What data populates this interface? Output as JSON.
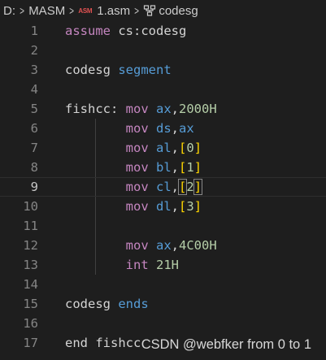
{
  "breadcrumb": {
    "drive": "D:",
    "folder": "MASM",
    "file_icon_label": "ASM",
    "file": "1.asm",
    "symbol": "codesg",
    "symbol_icon": "symbol-structure-icon",
    "separator_icon": "chevron-right-icon"
  },
  "editor": {
    "current_line": 9,
    "lines": [
      {
        "num": "1",
        "tokens": [
          {
            "t": "assume ",
            "c": "op"
          },
          {
            "t": "cs:codesg",
            "c": "ident"
          }
        ]
      },
      {
        "num": "2",
        "tokens": []
      },
      {
        "num": "3",
        "tokens": [
          {
            "t": "codesg ",
            "c": "ident"
          },
          {
            "t": "segment",
            "c": "kw"
          }
        ]
      },
      {
        "num": "4",
        "tokens": []
      },
      {
        "num": "5",
        "tokens": [
          {
            "t": "fishcc: ",
            "c": "ident"
          },
          {
            "t": "mov ",
            "c": "op"
          },
          {
            "t": "ax",
            "c": "kw"
          },
          {
            "t": ",",
            "c": "ident"
          },
          {
            "t": "2000H",
            "c": "num"
          }
        ]
      },
      {
        "num": "6",
        "tokens": [
          {
            "t": "        ",
            "c": "ident"
          },
          {
            "t": "mov ",
            "c": "op"
          },
          {
            "t": "ds",
            "c": "kw"
          },
          {
            "t": ",",
            "c": "ident"
          },
          {
            "t": "ax",
            "c": "kw"
          }
        ]
      },
      {
        "num": "7",
        "tokens": [
          {
            "t": "        ",
            "c": "ident"
          },
          {
            "t": "mov ",
            "c": "op"
          },
          {
            "t": "al",
            "c": "kw"
          },
          {
            "t": ",",
            "c": "ident"
          },
          {
            "t": "[",
            "c": "bracket"
          },
          {
            "t": "0",
            "c": "num"
          },
          {
            "t": "]",
            "c": "bracket"
          }
        ]
      },
      {
        "num": "8",
        "tokens": [
          {
            "t": "        ",
            "c": "ident"
          },
          {
            "t": "mov ",
            "c": "op"
          },
          {
            "t": "bl",
            "c": "kw"
          },
          {
            "t": ",",
            "c": "ident"
          },
          {
            "t": "[",
            "c": "bracket"
          },
          {
            "t": "1",
            "c": "num"
          },
          {
            "t": "]",
            "c": "bracket"
          }
        ]
      },
      {
        "num": "9",
        "tokens": [
          {
            "t": "        ",
            "c": "ident"
          },
          {
            "t": "mov ",
            "c": "op"
          },
          {
            "t": "cl",
            "c": "kw"
          },
          {
            "t": ",",
            "c": "ident"
          },
          {
            "t": "[",
            "c": "bracket-hl"
          },
          {
            "t": "2",
            "c": "num"
          },
          {
            "t": "]",
            "c": "bracket-hl"
          }
        ]
      },
      {
        "num": "10",
        "tokens": [
          {
            "t": "        ",
            "c": "ident"
          },
          {
            "t": "mov ",
            "c": "op"
          },
          {
            "t": "dl",
            "c": "kw"
          },
          {
            "t": ",",
            "c": "ident"
          },
          {
            "t": "[",
            "c": "bracket"
          },
          {
            "t": "3",
            "c": "num"
          },
          {
            "t": "]",
            "c": "bracket"
          }
        ]
      },
      {
        "num": "11",
        "tokens": []
      },
      {
        "num": "12",
        "tokens": [
          {
            "t": "        ",
            "c": "ident"
          },
          {
            "t": "mov ",
            "c": "op"
          },
          {
            "t": "ax",
            "c": "kw"
          },
          {
            "t": ",",
            "c": "ident"
          },
          {
            "t": "4C00H",
            "c": "num"
          }
        ]
      },
      {
        "num": "13",
        "tokens": [
          {
            "t": "        ",
            "c": "ident"
          },
          {
            "t": "int ",
            "c": "op"
          },
          {
            "t": "21H",
            "c": "num"
          }
        ]
      },
      {
        "num": "14",
        "tokens": []
      },
      {
        "num": "15",
        "tokens": [
          {
            "t": "codesg ",
            "c": "ident"
          },
          {
            "t": "ends",
            "c": "kw"
          }
        ]
      },
      {
        "num": "16",
        "tokens": []
      },
      {
        "num": "17",
        "tokens": [
          {
            "t": "end ",
            "c": "ident"
          },
          {
            "t": "fishcc",
            "c": "ident"
          }
        ]
      }
    ]
  },
  "watermark": "CSDN @webfker from 0 to 1",
  "colors": {
    "background": "#1e1e1e",
    "keyword": "#569cd6",
    "instruction": "#c586c0",
    "number": "#b5cea8",
    "bracket": "#ffd700",
    "line_number": "#858585"
  }
}
